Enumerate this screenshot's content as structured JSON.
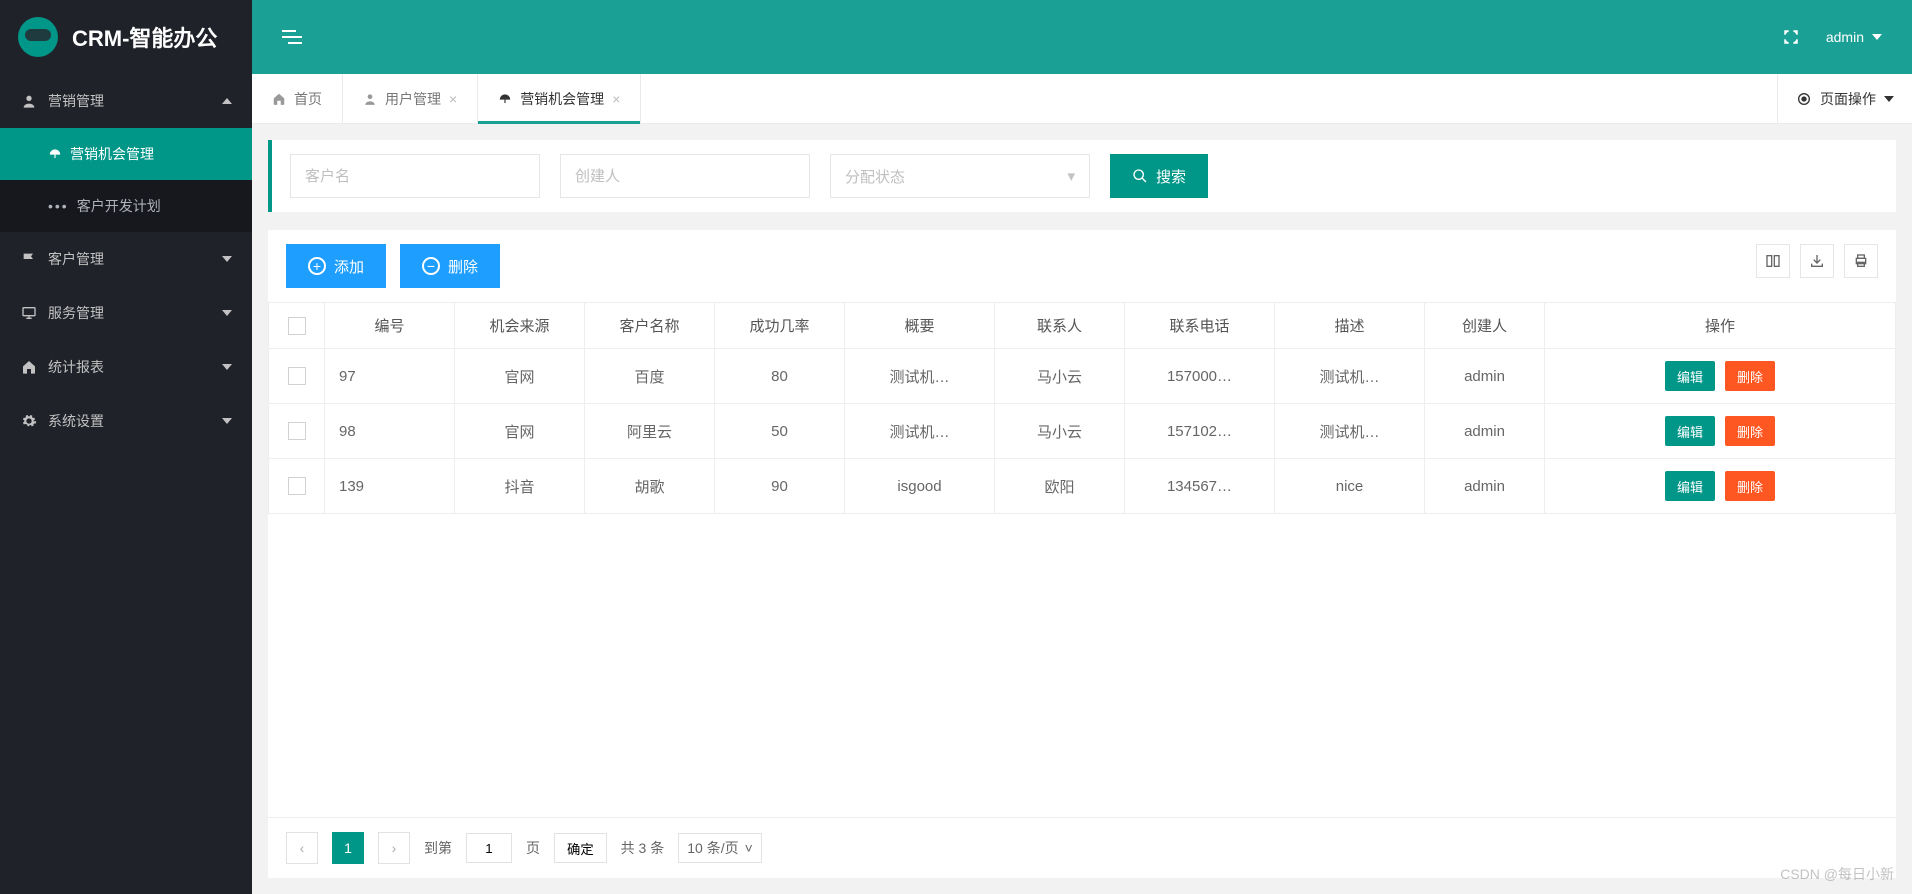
{
  "brand": {
    "title": "CRM-智能办公"
  },
  "sidebar": {
    "items": [
      {
        "label": "营销管理",
        "expanded": true,
        "children": [
          {
            "label": "营销机会管理",
            "active": true
          },
          {
            "label": "客户开发计划"
          }
        ]
      },
      {
        "label": "客户管理"
      },
      {
        "label": "服务管理"
      },
      {
        "label": "统计报表"
      },
      {
        "label": "系统设置"
      }
    ]
  },
  "topbar": {
    "user": "admin"
  },
  "tabs": [
    {
      "label": "首页",
      "closable": false
    },
    {
      "label": "用户管理",
      "closable": true
    },
    {
      "label": "营销机会管理",
      "closable": true,
      "active": true
    }
  ],
  "pageOps": {
    "label": "页面操作"
  },
  "search": {
    "customer_placeholder": "客户名",
    "creator_placeholder": "创建人",
    "state_placeholder": "分配状态",
    "button": "搜索"
  },
  "toolbar": {
    "add_label": "添加",
    "delete_label": "删除"
  },
  "table": {
    "headers": [
      "",
      "编号",
      "机会来源",
      "客户名称",
      "成功几率",
      "概要",
      "联系人",
      "联系电话",
      "描述",
      "创建人",
      "操作"
    ],
    "edit_label": "编辑",
    "delete_label": "删除",
    "rows": [
      {
        "id": "97",
        "source": "官网",
        "customer": "百度",
        "rate": "80",
        "summary": "测试机…",
        "contact": "马小云",
        "phone": "157000…",
        "desc": "测试机…",
        "creator": "admin"
      },
      {
        "id": "98",
        "source": "官网",
        "customer": "阿里云",
        "rate": "50",
        "summary": "测试机…",
        "contact": "马小云",
        "phone": "157102…",
        "desc": "测试机…",
        "creator": "admin"
      },
      {
        "id": "139",
        "source": "抖音",
        "customer": "胡歌",
        "rate": "90",
        "summary": "isgood",
        "contact": "欧阳",
        "phone": "134567…",
        "desc": "nice",
        "creator": "admin"
      }
    ]
  },
  "pagination": {
    "current": "1",
    "goto_prefix": "到第",
    "page_input": "1",
    "goto_suffix": "页",
    "confirm": "确定",
    "total": "共 3 条",
    "page_size": "10 条/页"
  },
  "watermark": "CSDN @每日小新"
}
